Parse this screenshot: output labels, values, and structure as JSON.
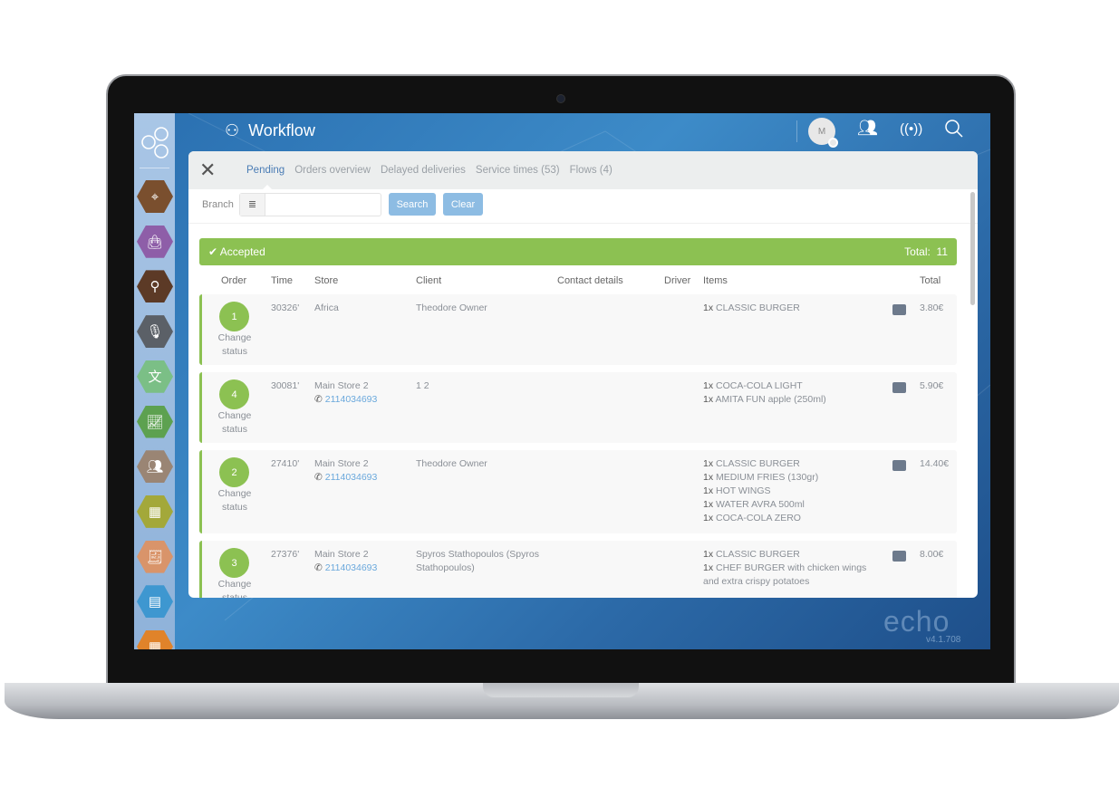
{
  "app": {
    "title": "Workflow",
    "logo": "echo",
    "version": "v4.1.708",
    "user_initial": "M"
  },
  "header_icons": [
    "users-icon",
    "broadcast-icon",
    "search-icon"
  ],
  "sidebar": {
    "items": [
      {
        "icon": "map-pin-icon",
        "color": "#7a4f2e"
      },
      {
        "icon": "shopping-bag-icon",
        "color": "#8e5ea8"
      },
      {
        "icon": "route-icon",
        "color": "#5c3a26"
      },
      {
        "icon": "microphone-icon",
        "color": "#5b6067"
      },
      {
        "icon": "translate-icon",
        "color": "#7bbf86"
      },
      {
        "icon": "chart-icon",
        "color": "#5da150"
      },
      {
        "icon": "delivery-users-icon",
        "color": "#9a8574"
      },
      {
        "icon": "boxes-icon",
        "color": "#a3a83a"
      },
      {
        "icon": "receipt-icon",
        "color": "#d9946a"
      },
      {
        "icon": "pos-icon",
        "color": "#3e97d0"
      },
      {
        "icon": "calendar-icon",
        "color": "#e0832a"
      }
    ]
  },
  "tabs": [
    "Pending",
    "Orders overview",
    "Delayed deliveries",
    "Service times (53)",
    "Flows (4)"
  ],
  "filter": {
    "branch_label": "Branch",
    "branch_value": "",
    "search": "Search",
    "clear": "Clear"
  },
  "group": {
    "status": "Accepted",
    "total_label": "Total:",
    "total": "11",
    "color": "#8cc152"
  },
  "columns": [
    "Order",
    "Time",
    "Store",
    "Client",
    "Contact details",
    "Driver",
    "Items",
    "Total"
  ],
  "change_status": "Change status",
  "orders": [
    {
      "order": "1",
      "time": "30326'",
      "store": "Africa",
      "phone": "",
      "client": "Theodore Owner",
      "items": [
        {
          "q": "1x",
          "n": "CLASSIC BURGER"
        }
      ],
      "total": "3.80€"
    },
    {
      "order": "4",
      "time": "30081'",
      "store": "Main Store 2",
      "phone": "2114034693",
      "client": "1 2",
      "items": [
        {
          "q": "1x",
          "n": "COCA-COLA LIGHT"
        },
        {
          "q": "1x",
          "n": "AMITA FUN apple (250ml)"
        }
      ],
      "total": "5.90€"
    },
    {
      "order": "2",
      "time": "27410'",
      "store": "Main Store 2",
      "phone": "2114034693",
      "client": "Theodore Owner",
      "items": [
        {
          "q": "1x",
          "n": "CLASSIC BURGER"
        },
        {
          "q": "1x",
          "n": "MEDIUM FRIES (130gr)"
        },
        {
          "q": "1x",
          "n": "HOT WINGS"
        },
        {
          "q": "1x",
          "n": "WATER AVRA 500ml"
        },
        {
          "q": "1x",
          "n": "COCA-COLA ZERO"
        }
      ],
      "total": "14.40€"
    },
    {
      "order": "3",
      "time": "27376'",
      "store": "Main Store 2",
      "phone": "2114034693",
      "client": "Spyros Stathopoulos (Spyros Stathopoulos)",
      "items": [
        {
          "q": "1x",
          "n": "CLASSIC BURGER"
        },
        {
          "q": "1x",
          "n": "CHEF BURGER with chicken wings and extra crispy potatoes"
        }
      ],
      "total": "8.00€"
    }
  ]
}
